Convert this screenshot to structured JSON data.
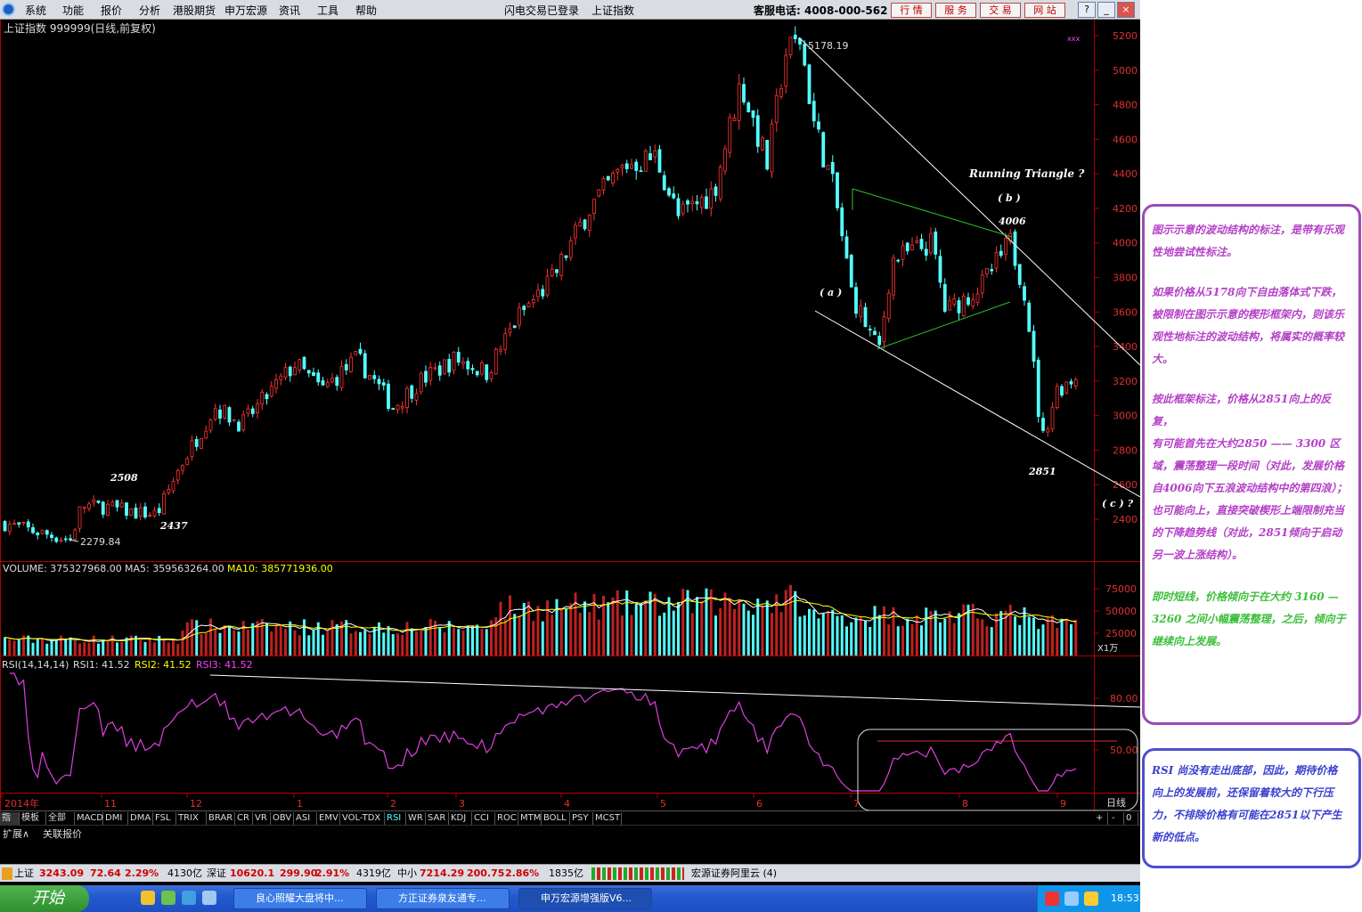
{
  "menu": [
    "系统",
    "功能",
    "报价",
    "分析",
    "港股期货",
    "申万宏源",
    "资讯",
    "工具",
    "帮助"
  ],
  "header_center": [
    "闪电交易已登录",
    "上证指数"
  ],
  "service_phone": "客服电话: 4008-000-562",
  "top_buttons": [
    "行 情",
    "服 务",
    "交 易",
    "网 站"
  ],
  "window_controls": [
    "?",
    "_",
    "□",
    "×"
  ],
  "chart_title": "上证指数 999999(日线,前复权)",
  "mark_xxx": "xxx",
  "price_axis_ticks": [
    "5200",
    "5000",
    "4800",
    "4600",
    "4400",
    "4200",
    "4000",
    "3800",
    "3600",
    "3400",
    "3200",
    "3000",
    "2800",
    "2600",
    "2400"
  ],
  "annotations": {
    "high": "5178.19",
    "low": "2279.84",
    "p2508": "2508",
    "p2437": "2437",
    "running_triangle": "Running Triangle ?",
    "wave_a": "( a )",
    "wave_b": "( b )",
    "wave_c": "( c ) ?",
    "p4006": "4006",
    "p2851": "2851"
  },
  "volume_header": {
    "label": "VOLUME: 375327968.00",
    "ma5": "MA5: 359563264.00",
    "ma10": "MA10: 385771936.00"
  },
  "volume_axis_ticks": [
    "75000",
    "50000",
    "25000"
  ],
  "volume_unit": "X1万",
  "rsi_header": {
    "label": "RSI(14,14,14)",
    "rsi1": "RSI1: 41.52",
    "rsi2": "RSI2: 41.52",
    "rsi3": "RSI3: 41.52"
  },
  "rsi_axis_ticks": [
    "80.00",
    "50.00"
  ],
  "date_axis": [
    "2014年",
    "11",
    "12",
    "1",
    "2",
    "3",
    "4",
    "5",
    "6",
    "7",
    "8",
    "9"
  ],
  "period_label": "日线",
  "indicator_tabs": [
    "指标",
    "模板",
    "全部",
    "MACD",
    "DMI",
    "DMA",
    "FSL",
    "TRIX",
    "BRAR",
    "CR",
    "VR",
    "OBV",
    "ASI",
    "EMV",
    "VOL-TDX",
    "RSI",
    "WR",
    "SAR",
    "KDJ",
    "CCI",
    "ROC",
    "MTM",
    "BOLL",
    "PSY",
    "MCST"
  ],
  "tab_controls": [
    "+",
    "-",
    "0"
  ],
  "sub_tabs": [
    "扩展∧",
    "关联报价"
  ],
  "status_bar": {
    "sh_name": "上证",
    "sh_value": "3243.09",
    "sh_change": "72.64",
    "sh_pct": "2.29%",
    "sh_amount": "4130亿",
    "sz_name": "深证",
    "sz_value": "10620.1",
    "sz_change": "299.90",
    "sz_pct": "2.91%",
    "sz_amount": "4319亿",
    "zx_name": "中小",
    "zx_value": "7214.29",
    "zx_change": "200.75",
    "zx_pct": "2.86%",
    "zx_amount": "1835亿",
    "broker": "宏源证券阿里云 (4)"
  },
  "taskbar": {
    "start": "开始",
    "tasks": [
      "良心照耀大盘将中...",
      "方正证券泉友通专...",
      "申万宏源增强版V6..."
    ],
    "clock": "18:53"
  },
  "notes": {
    "purple": [
      "图示示意的波动结构的标注，是带有乐观性地尝试性标注。",
      "如果价格从5178向下自由落体式下跌，被限制在图示示意的楔形框架内，则该乐观性地标注的波动结构，将属实的概率较大。",
      "按此框架标注，价格从2851向上的反复，",
      "有可能首先在大约2850 —— 3300 区域，震荡整理一段时间（对此，发展价格自4006向下五浪波动结构中的第四浪）；",
      "也可能向上，直接突破楔形上端限制充当的下降趋势线（对此，2851倾向于启动另一波上涨结构）。"
    ],
    "green": "即时短线，价格倾向于在大约 3160 — 3260 之间小幅震荡整理，之后，倾向于继续向上发展。",
    "blue": "RSI 尚没有走出底部，因此，期待价格向上的发展前，还保留着较大的下行压力，不排除价格有可能在2851以下产生新的低点。"
  },
  "chart_data": {
    "type": "candlestick",
    "title": "上证指数 999999(日线,前复权)",
    "ylim": [
      2300,
      5250
    ],
    "monthly_path": [
      {
        "month": "2014-10",
        "close": 2380
      },
      {
        "month": "2014-11",
        "low": 2280,
        "close": 2500
      },
      {
        "month": "2014-12",
        "close": 3230
      },
      {
        "month": "2015-01",
        "close": 3200
      },
      {
        "month": "2015-02",
        "close": 3310
      },
      {
        "month": "2015-03",
        "close": 3750
      },
      {
        "month": "2015-04",
        "close": 4440
      },
      {
        "month": "2015-05",
        "close": 4610
      },
      {
        "month": "2015-06",
        "high": 5178.19,
        "close": 4280
      },
      {
        "month": "2015-07",
        "low": 3370,
        "close": 3660
      },
      {
        "month": "2015-08",
        "high": 4006,
        "low": 2851,
        "close": 3200
      },
      {
        "month": "2015-09",
        "close": 3243.09
      }
    ],
    "labeled_points": {
      "low_2014": 2279.84,
      "p2508": 2508,
      "p2437": 2437,
      "high": 5178.19,
      "p4006": 4006,
      "p2851": 2851
    },
    "volume": {
      "ylim": [
        0,
        90000
      ],
      "unit": "万",
      "last": 37532.7968,
      "ma5": 35956.3264,
      "ma10": 38577.1936
    },
    "rsi": {
      "ylim": [
        0,
        100
      ],
      "last": 41.52,
      "levels": [
        80,
        50
      ]
    }
  },
  "colors": {
    "up": "#ff3232",
    "down": "#54ffff",
    "bg": "#000000",
    "axis": "#b00000",
    "rsi": "#ff40ff",
    "ma5": "#ffffff",
    "ma10": "#ffff00"
  }
}
